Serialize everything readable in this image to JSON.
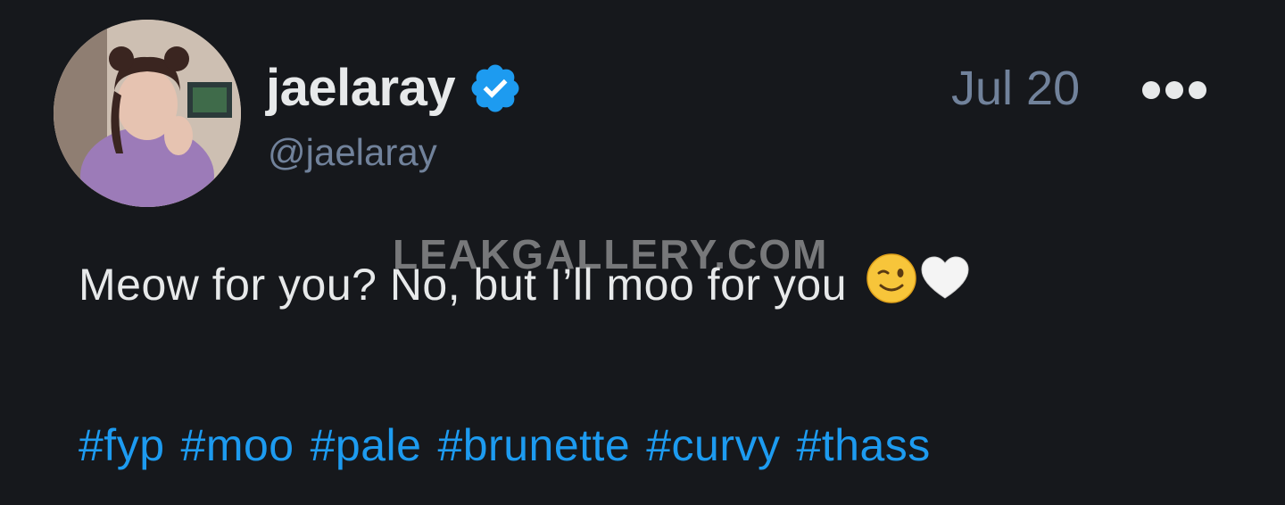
{
  "post": {
    "display_name": "jaelaray",
    "handle": "@jaelaray",
    "date": "Jul 20",
    "verified": true,
    "avatar_icon": "profile-photo",
    "more_icon": "ellipsis-icon",
    "text": "Meow for you? No, but I’ll moo for you",
    "emojis": [
      "winking-face-emoji",
      "white-heart-emoji"
    ],
    "hashtags": [
      "#fyp",
      "#moo",
      "#pale",
      "#brunette",
      "#curvy",
      "#thass"
    ]
  },
  "watermark": "LEAKGALLERY.COM",
  "colors": {
    "background": "#16181c",
    "text": "#e7e9ea",
    "muted": "#71829b",
    "link": "#1d9bf0",
    "verified": "#1d9bf0"
  }
}
